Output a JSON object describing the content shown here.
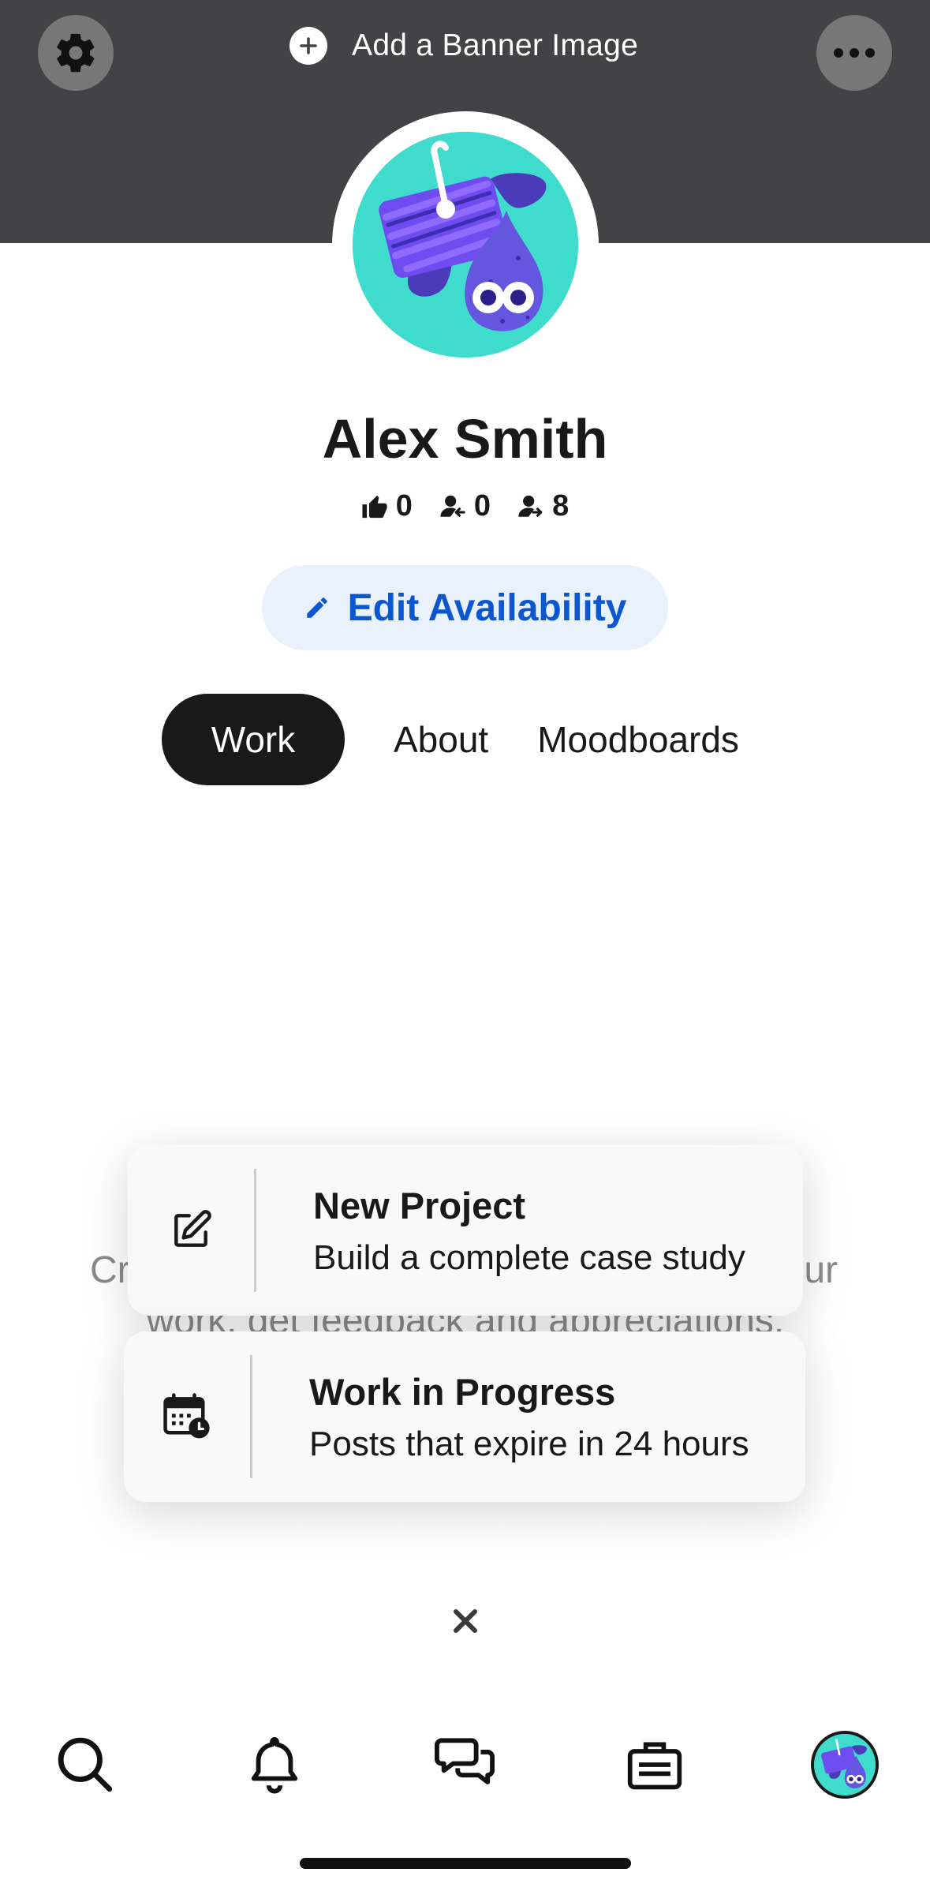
{
  "banner": {
    "add_banner_label": "Add a Banner Image",
    "background_color": "#434345",
    "settings_icon": "gear-icon",
    "more_icon": "ellipsis-icon"
  },
  "profile": {
    "name": "Alex Smith",
    "stats": {
      "appreciations": "0",
      "followers": "0",
      "following": "8"
    },
    "edit_availability_label": "Edit Availability",
    "accent_color": "#0b57d0"
  },
  "tabs": [
    {
      "label": "Work",
      "active": true
    },
    {
      "label": "About",
      "active": false
    },
    {
      "label": "Moodboards",
      "active": false
    }
  ],
  "background_text": {
    "line1_left": "Cr",
    "line1_right": "ur",
    "line2": "work. get feedback and appreciations."
  },
  "menu": {
    "new_project": {
      "title": "New Project",
      "subtitle": "Build a complete case study",
      "icon": "edit-square-icon"
    },
    "work_in_progress": {
      "title": "Work in Progress",
      "subtitle": "Posts that expire in 24 hours",
      "icon": "calendar-clock-icon"
    }
  },
  "bottom_nav": [
    "search-icon",
    "bell-icon",
    "messages-icon",
    "briefcase-icon",
    "profile-avatar"
  ]
}
